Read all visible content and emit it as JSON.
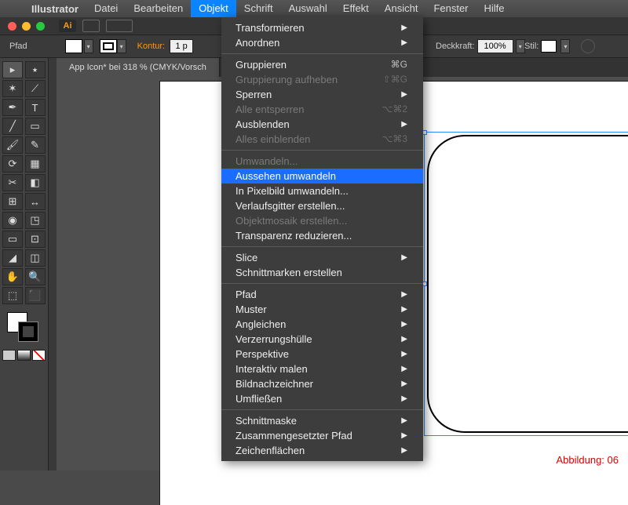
{
  "menubar": {
    "app": "Illustrator",
    "items": [
      "Datei",
      "Bearbeiten",
      "Objekt",
      "Schrift",
      "Auswahl",
      "Effekt",
      "Ansicht",
      "Fenster",
      "Hilfe"
    ],
    "active_index": 2
  },
  "controlbar": {
    "left_label": "Pfad",
    "kontur_label": "Kontur:",
    "kontur_value": "1 p",
    "deckkraft_label": "Deckkraft:",
    "deckkraft_value": "100%",
    "stil_label": "Stil:"
  },
  "tab": {
    "title": "App Icon* bei 318 % (CMYK/Vorsch"
  },
  "dropdown": {
    "groups": [
      [
        {
          "label": "Transformieren",
          "sub": true
        },
        {
          "label": "Anordnen",
          "sub": true
        }
      ],
      [
        {
          "label": "Gruppieren",
          "shortcut": "⌘G"
        },
        {
          "label": "Gruppierung aufheben",
          "shortcut": "⇧⌘G",
          "disabled": true
        },
        {
          "label": "Sperren",
          "sub": true
        },
        {
          "label": "Alle entsperren",
          "shortcut": "⌥⌘2",
          "disabled": true
        },
        {
          "label": "Ausblenden",
          "sub": true
        },
        {
          "label": "Alles einblenden",
          "shortcut": "⌥⌘3",
          "disabled": true
        }
      ],
      [
        {
          "label": "Umwandeln...",
          "disabled": true
        },
        {
          "label": "Aussehen umwandeln",
          "highlight": true
        },
        {
          "label": "In Pixelbild umwandeln..."
        },
        {
          "label": "Verlaufsgitter erstellen..."
        },
        {
          "label": "Objektmosaik erstellen...",
          "disabled": true
        },
        {
          "label": "Transparenz reduzieren..."
        }
      ],
      [
        {
          "label": "Slice",
          "sub": true
        },
        {
          "label": "Schnittmarken erstellen"
        }
      ],
      [
        {
          "label": "Pfad",
          "sub": true
        },
        {
          "label": "Muster",
          "sub": true
        },
        {
          "label": "Angleichen",
          "sub": true
        },
        {
          "label": "Verzerrungshülle",
          "sub": true
        },
        {
          "label": "Perspektive",
          "sub": true
        },
        {
          "label": "Interaktiv malen",
          "sub": true
        },
        {
          "label": "Bildnachzeichner",
          "sub": true
        },
        {
          "label": "Umfließen",
          "sub": true
        }
      ],
      [
        {
          "label": "Schnittmaske",
          "sub": true
        },
        {
          "label": "Zusammengesetzter Pfad",
          "sub": true
        },
        {
          "label": "Zeichenflächen",
          "sub": true
        }
      ]
    ]
  },
  "ai_badge": "Ai",
  "figure_label": "Abbildung: 06",
  "tool_icons": [
    "▸",
    "⭑",
    "✶",
    "⟋",
    "✒",
    "T",
    "╱",
    "▭",
    "🖌",
    "✎",
    "⟳",
    "▦",
    "✂",
    "◧",
    "⊞",
    "↔",
    "◉",
    "◳",
    "▭",
    "⊡",
    "◢",
    "◫",
    "✋",
    "🔍",
    "⬚",
    "⬛"
  ]
}
